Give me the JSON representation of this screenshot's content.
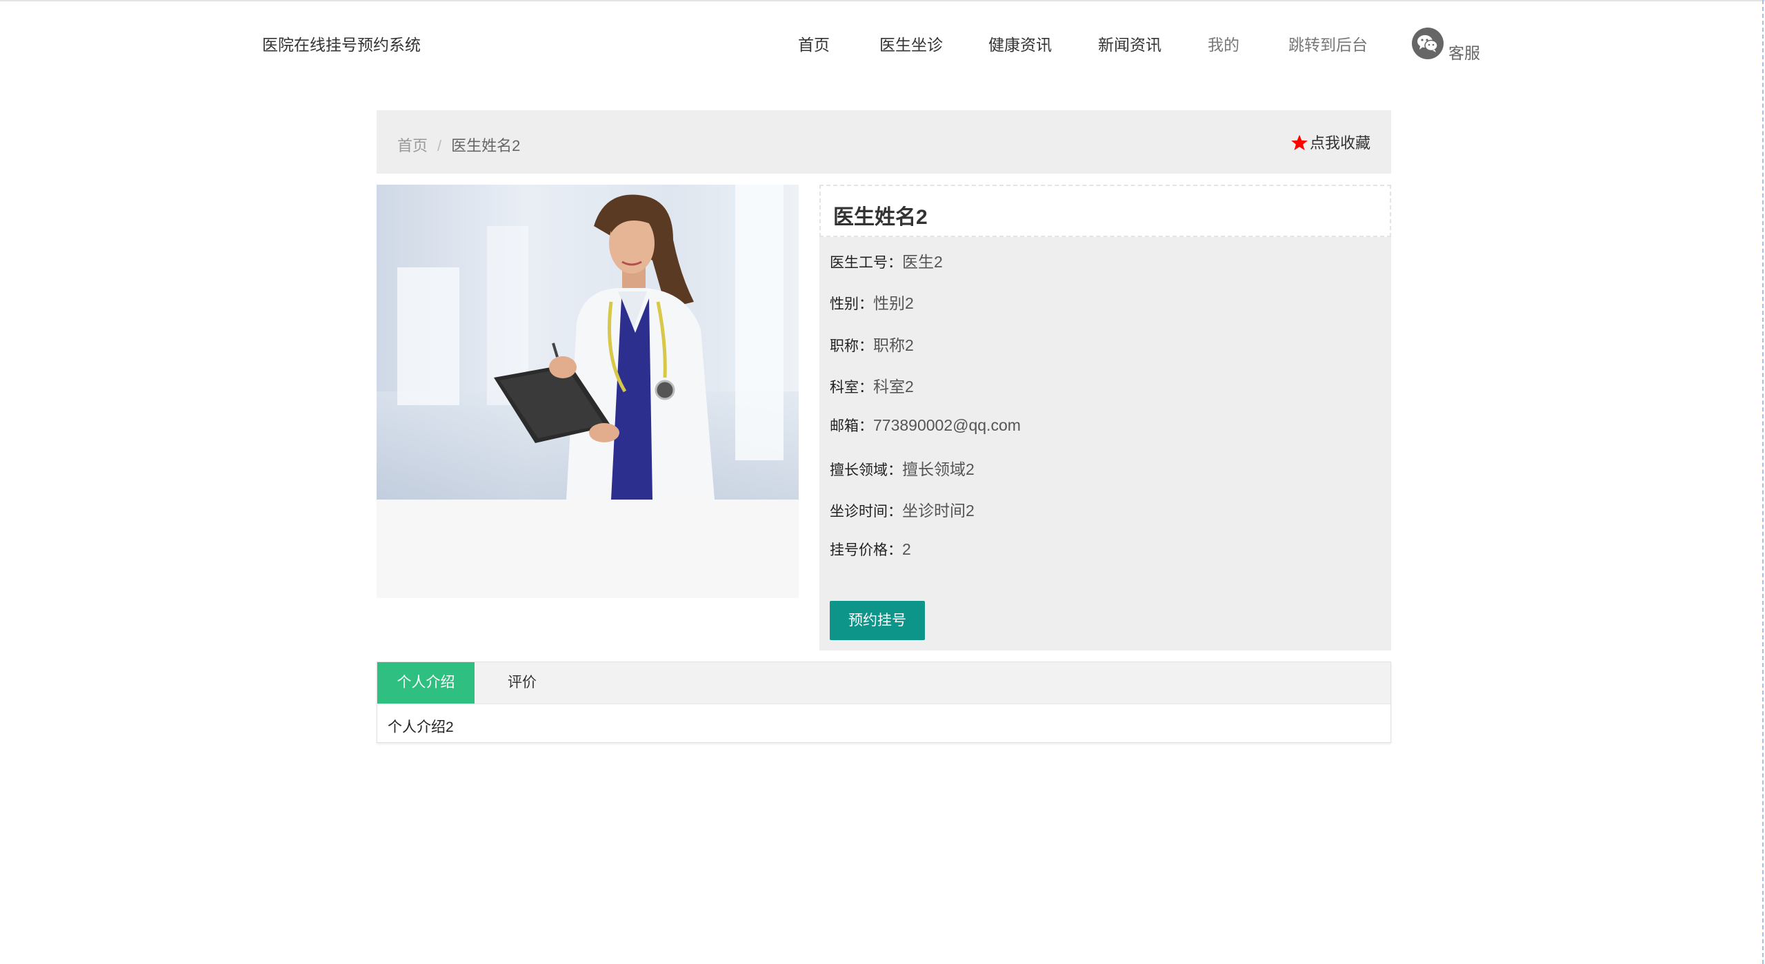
{
  "header": {
    "site_title": "医院在线挂号预约系统",
    "nav": [
      {
        "label": "首页"
      },
      {
        "label": "医生坐诊"
      },
      {
        "label": "健康资讯"
      },
      {
        "label": "新闻资讯"
      },
      {
        "label": "我的"
      },
      {
        "label": "跳转到后台"
      }
    ],
    "customer_service": "客服",
    "customer_service_icon": "wechat-icon"
  },
  "breadcrumb": {
    "home": "首页",
    "separator": "/",
    "current": "医生姓名2"
  },
  "favorite": {
    "label": "点我收藏",
    "icon": "star-icon",
    "icon_color": "#ff0000"
  },
  "doctor": {
    "name": "医生姓名2",
    "fields": [
      {
        "label": "医生工号：",
        "value": "医生2"
      },
      {
        "label": "性别：",
        "value": "性别2"
      },
      {
        "label": "职称：",
        "value": "职称2"
      },
      {
        "label": "科室：",
        "value": "科室2"
      },
      {
        "label": "邮箱：",
        "value": "773890002@qq.com"
      },
      {
        "label": "擅长领域：",
        "value": "擅长领域2"
      },
      {
        "label": "坐诊时间：",
        "value": "坐诊时间2"
      },
      {
        "label": "挂号价格：",
        "value": "2"
      }
    ],
    "book_button": "预约挂号",
    "book_button_color": "#0e958a"
  },
  "tabs": {
    "items": [
      {
        "label": "个人介绍"
      },
      {
        "label": "评价"
      }
    ],
    "active_color": "#2fc081",
    "content": "个人介绍2"
  }
}
